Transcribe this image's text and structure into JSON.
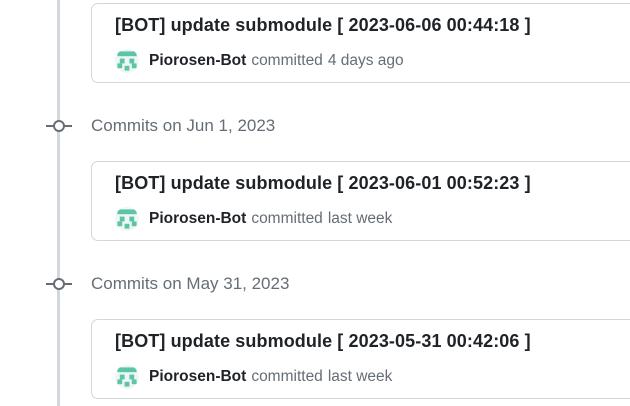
{
  "commit_groups": [
    {
      "header": "",
      "commits": [
        {
          "title": "[BOT] update submodule [ 2023-06-06 00:44:18 ]",
          "author": "Piorosen-Bot",
          "action": "committed",
          "relative_time": "4 days ago"
        }
      ]
    },
    {
      "header": "Commits on Jun 1, 2023",
      "commits": [
        {
          "title": "[BOT] update submodule [ 2023-06-01 00:52:23 ]",
          "author": "Piorosen-Bot",
          "action": "committed",
          "relative_time": "last week"
        }
      ]
    },
    {
      "header": "Commits on May 31, 2023",
      "commits": [
        {
          "title": "[BOT] update submodule [ 2023-05-31 00:42:06 ]",
          "author": "Piorosen-Bot",
          "action": "committed",
          "relative_time": "last week"
        }
      ]
    }
  ],
  "icons": {
    "timeline_node": "git-commit-icon",
    "avatar": "identicon-avatar"
  },
  "colors": {
    "timeline": "#d0d7de",
    "avatar_green": "#5ec4a8",
    "muted_text": "#656d76",
    "text": "#1f2328"
  }
}
